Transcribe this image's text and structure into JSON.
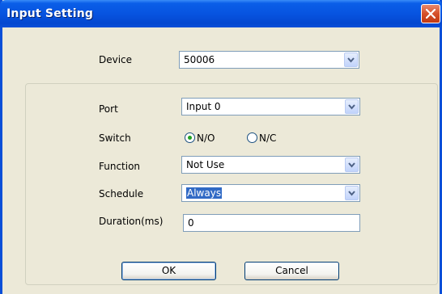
{
  "dialog": {
    "title": "Input Setting"
  },
  "device": {
    "label": "Device",
    "value": "50006"
  },
  "port": {
    "label": "Port",
    "value": "Input 0"
  },
  "switch": {
    "label": "Switch",
    "options": [
      "N/O",
      "N/C"
    ],
    "selected": "N/O"
  },
  "function": {
    "label": "Function",
    "value": "Not Use"
  },
  "schedule": {
    "label": "Schedule",
    "value": "Always"
  },
  "duration": {
    "label": "Duration(ms)",
    "value": "0"
  },
  "buttons": {
    "ok": "OK",
    "cancel": "Cancel"
  },
  "colors": {
    "titlebar": "#0754e0",
    "dialog_bg": "#ece9d8",
    "close_button": "#d6502a",
    "selection": "#316ac5",
    "radio_dot": "#21a121"
  }
}
